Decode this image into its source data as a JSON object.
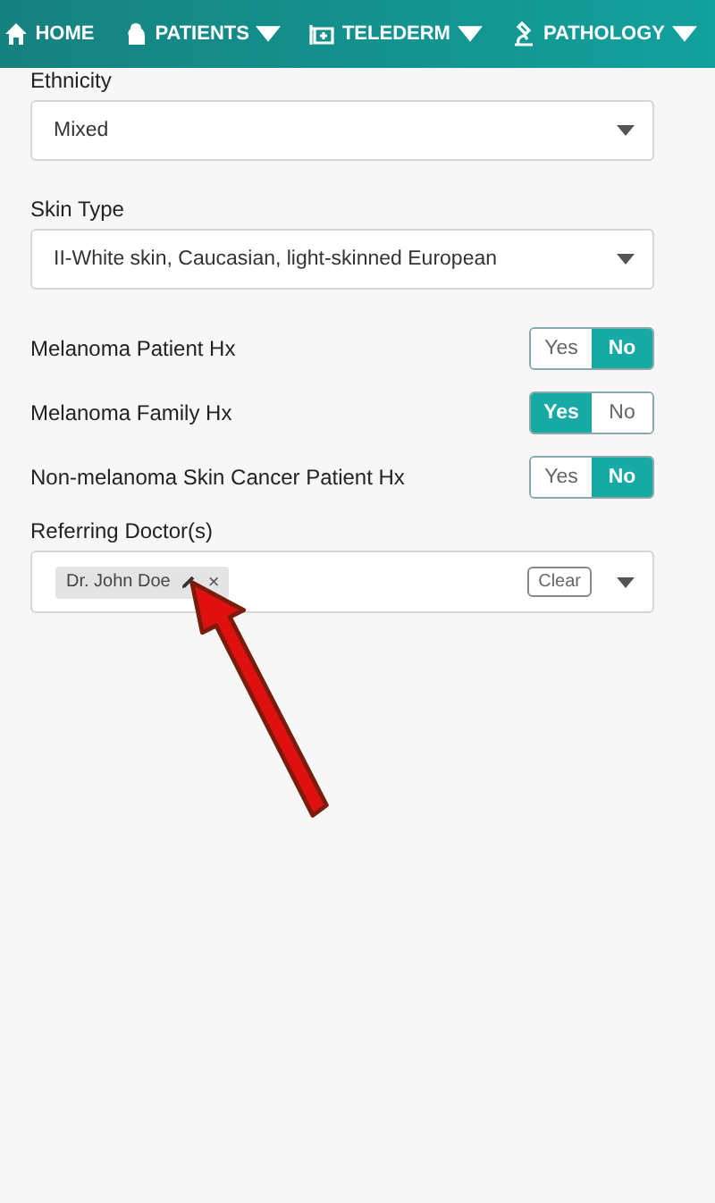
{
  "nav": {
    "items": [
      {
        "label": "HOME",
        "dropdown": false
      },
      {
        "label": "PATIENTS",
        "dropdown": true
      },
      {
        "label": "TELEDERM",
        "dropdown": true
      },
      {
        "label": "PATHOLOGY",
        "dropdown": true
      }
    ]
  },
  "form": {
    "selects": [
      {
        "label": "Ethnicity",
        "value": "Mixed"
      },
      {
        "label": "Skin Type",
        "value": "II-White skin, Caucasian, light-skinned European"
      }
    ],
    "toggles": [
      {
        "label": "Melanoma Patient Hx",
        "options": [
          {
            "label": "Yes",
            "selected": false
          },
          {
            "label": "No",
            "selected": true
          }
        ]
      },
      {
        "label": "Melanoma Family Hx",
        "options": [
          {
            "label": "Yes",
            "selected": true
          },
          {
            "label": "No",
            "selected": false
          }
        ]
      },
      {
        "label": "Non-melanoma Skin Cancer Patient Hx",
        "options": [
          {
            "label": "Yes",
            "selected": false
          },
          {
            "label": "No",
            "selected": true
          }
        ]
      }
    ],
    "referring": {
      "label": "Referring Doctor(s)",
      "chips": [
        "Dr. John Doe"
      ],
      "clear": "Clear",
      "close_mark": "×"
    }
  }
}
